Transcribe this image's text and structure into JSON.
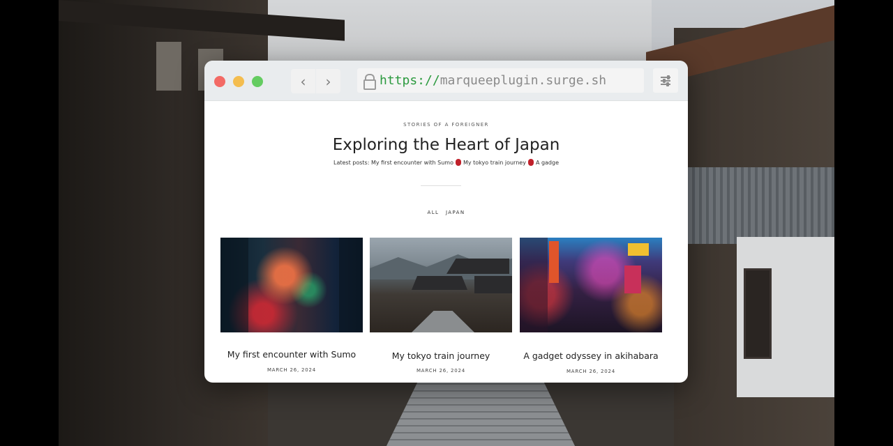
{
  "browser": {
    "url_scheme": "https://",
    "url_host": "marqueeplugin.surge.sh",
    "back_icon": "chevron-left-icon",
    "forward_icon": "chevron-right-icon",
    "lock_icon": "lock-icon",
    "settings_icon": "sliders-icon"
  },
  "page": {
    "eyebrow": "STORIES OF A FOREIGNER",
    "title": "Exploring the Heart of Japan",
    "latest_prefix": "Latest posts:",
    "latest_items": [
      "My first encounter with Sumo",
      "My tokyo train journey",
      "A gadge"
    ],
    "filters": [
      "ALL",
      "JAPAN"
    ]
  },
  "posts": [
    {
      "title": "My first encounter with Sumo",
      "date": "MARCH 26, 2024"
    },
    {
      "title": "My tokyo train journey",
      "date": "MARCH 26, 2024"
    },
    {
      "title": "A gadget odyssey in akihabara",
      "date": "MARCH 26, 2024"
    }
  ],
  "colors": {
    "traffic_red": "#f36a65",
    "traffic_yellow": "#f4bd4f",
    "traffic_green": "#64cc61",
    "url_scheme": "#2c9a3f",
    "latest_separator": "#c0202a"
  }
}
